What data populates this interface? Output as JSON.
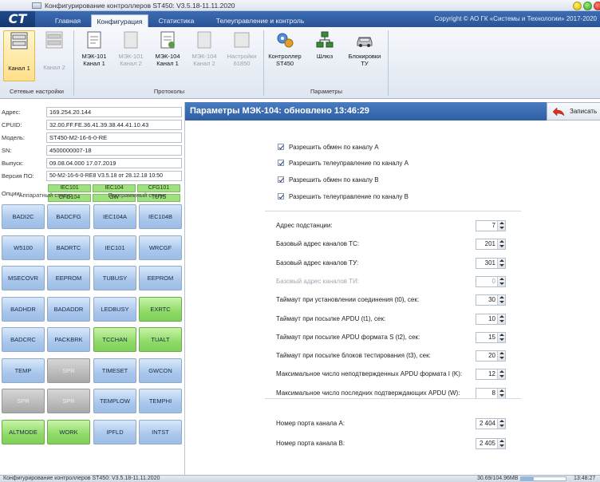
{
  "window": {
    "title": "Конфигурирование контроллеров ST450: V3.5.18-11.11.2020"
  },
  "logo": "CT",
  "tabs": [
    {
      "label": "Главная",
      "active": false
    },
    {
      "label": "Конфигурация",
      "active": true
    },
    {
      "label": "Статистика",
      "active": false
    },
    {
      "label": "Телеуправление и контроль",
      "active": false
    }
  ],
  "copyright": "Copyright © АО ГК «Системы и Технологии» 2017-2020",
  "ribbon": {
    "group1": {
      "label": "Сетевые настройки",
      "buttons": [
        {
          "label": "Канал 1",
          "enabled": true,
          "selected": true
        },
        {
          "label": "Канал 2",
          "enabled": false
        }
      ]
    },
    "group2": {
      "label": "Протоколы",
      "buttons": [
        {
          "line1": "МЭК-101",
          "line2": "Канал 1",
          "enabled": true
        },
        {
          "line1": "МЭК-101",
          "line2": "Канал 2",
          "enabled": false
        },
        {
          "line1": "МЭК-104",
          "line2": "Канал 1",
          "enabled": true
        },
        {
          "line1": "МЭК-104",
          "line2": "Канал 2",
          "enabled": false
        },
        {
          "line1": "Настройки",
          "line2": "61850",
          "enabled": false
        }
      ]
    },
    "group3": {
      "label": "Параметры",
      "buttons": [
        {
          "line1": "Контроллер",
          "line2": "ST450",
          "enabled": true
        },
        {
          "line1": "Шлюз",
          "line2": "",
          "enabled": true
        },
        {
          "line1": "Блокировки",
          "line2": "ТУ",
          "enabled": true
        }
      ]
    }
  },
  "info": {
    "address": {
      "label": "Адрес:",
      "value": "169.254.20.144"
    },
    "cpuid": {
      "label": "CPUID:",
      "value": "32.00.FF.FE.36.41.39.38.44.41.10.43"
    },
    "model": {
      "label": "Модель:",
      "value": "ST450-M2-16-6-0-RE"
    },
    "sn": {
      "label": "SN:",
      "value": "4500000007-18"
    },
    "release": {
      "label": "Выпуск:",
      "value": "09.08.04.000 17.07.2019"
    },
    "po_version": {
      "label": "Версия ПО:",
      "value": "50-M2-16-6-0-RE8 V3.5.18 от 28.12.18 10:50"
    },
    "options_label": "Опции:",
    "options": [
      "IEC101",
      "IEC104",
      "CFG101",
      "CFG104",
      "GW",
      "TUTS"
    ]
  },
  "status_headers": {
    "hardware": "Аппаратный статус",
    "software": "Программный статус"
  },
  "status_grid": [
    [
      {
        "label": "BADI2C",
        "color": "blue"
      },
      {
        "label": "BADCFG",
        "color": "blue"
      },
      {
        "label": "IEC104A",
        "color": "blue"
      },
      {
        "label": "IEC104B",
        "color": "blue"
      }
    ],
    [
      {
        "label": "W5100",
        "color": "blue"
      },
      {
        "label": "BADRTC",
        "color": "blue"
      },
      {
        "label": "IEC101",
        "color": "blue"
      },
      {
        "label": "WRCGF",
        "color": "blue"
      }
    ],
    [
      {
        "label": "MSECOVR",
        "color": "blue"
      },
      {
        "label": "EEPROM",
        "color": "blue"
      },
      {
        "label": "TUBUSY",
        "color": "blue"
      },
      {
        "label": "EEPROM",
        "color": "blue"
      }
    ],
    [
      {
        "label": "BADHDR",
        "color": "blue"
      },
      {
        "label": "BADADDR",
        "color": "blue"
      },
      {
        "label": "LEDBUSY",
        "color": "blue"
      },
      {
        "label": "EXRTC",
        "color": "green"
      }
    ],
    [
      {
        "label": "BADCRC",
        "color": "blue"
      },
      {
        "label": "PACKBRK",
        "color": "blue"
      },
      {
        "label": "TCCHAN",
        "color": "green"
      },
      {
        "label": "TUALT",
        "color": "green"
      }
    ],
    [
      {
        "label": "TEMP",
        "color": "blue"
      },
      {
        "label": "SPR",
        "color": "gray"
      },
      {
        "label": "TIMESET",
        "color": "blue"
      },
      {
        "label": "GWCON",
        "color": "blue"
      }
    ],
    [
      {
        "label": "SPR",
        "color": "gray"
      },
      {
        "label": "SPR",
        "color": "gray"
      },
      {
        "label": "TEMPLOW",
        "color": "blue"
      },
      {
        "label": "TEMPHI",
        "color": "blue"
      }
    ],
    [
      {
        "label": "ALTMODE",
        "color": "green"
      },
      {
        "label": "WORK",
        "color": "green"
      },
      {
        "label": "IPFLD",
        "color": "blue"
      },
      {
        "label": "INTST",
        "color": "blue"
      }
    ]
  ],
  "panel": {
    "title": "Параметры МЭК-104: обновлено 13:46:29",
    "save_label": "Записать",
    "checkboxes": [
      {
        "label": "Разрешить обмен по каналу А",
        "checked": true
      },
      {
        "label": "Разрешить телеуправление по каналу А",
        "checked": true
      },
      {
        "label": "Разрешить обмен по каналу В",
        "checked": true
      },
      {
        "label": "Разрешить телеуправление по каналу В",
        "checked": true
      }
    ],
    "params": [
      {
        "label": "Адрес подстанции:",
        "value": "7",
        "enabled": true
      },
      {
        "label": "Базовый адрес каналов ТС:",
        "value": "201",
        "enabled": true
      },
      {
        "label": "Базовый адрес каналов ТУ:",
        "value": "301",
        "enabled": true
      },
      {
        "label": "Базовый адрес каналов ТИ:",
        "value": "0",
        "enabled": false
      },
      {
        "label": "Таймаут при установлении соединения (t0), сек:",
        "value": "30",
        "enabled": true
      },
      {
        "label": "Таймаут при посылке APDU (t1), сек:",
        "value": "10",
        "enabled": true
      },
      {
        "label": "Таймаут при посылке APDU формата S (t2), сек:",
        "value": "15",
        "enabled": true
      },
      {
        "label": "Таймаут при посылке блоков тестирования (t3), сек:",
        "value": "20",
        "enabled": true
      },
      {
        "label": "Максимальное число неподтвержденных APDU формата I (K):",
        "value": "12",
        "enabled": true
      },
      {
        "label": "Максимальное число последних подтверждающих APDU (W):",
        "value": "8",
        "enabled": true
      }
    ],
    "ports": [
      {
        "label": "Номер порта канала А:",
        "value": "2 404"
      },
      {
        "label": "Номер порта канала В:",
        "value": "2 405"
      }
    ]
  },
  "statusbar": {
    "text": "Конфигурирование контроллеров ST450: V3.5.18-11.11.2020",
    "memory": "30.69/104.96MB",
    "memory_fraction": 0.29,
    "time": "13:48:27"
  }
}
